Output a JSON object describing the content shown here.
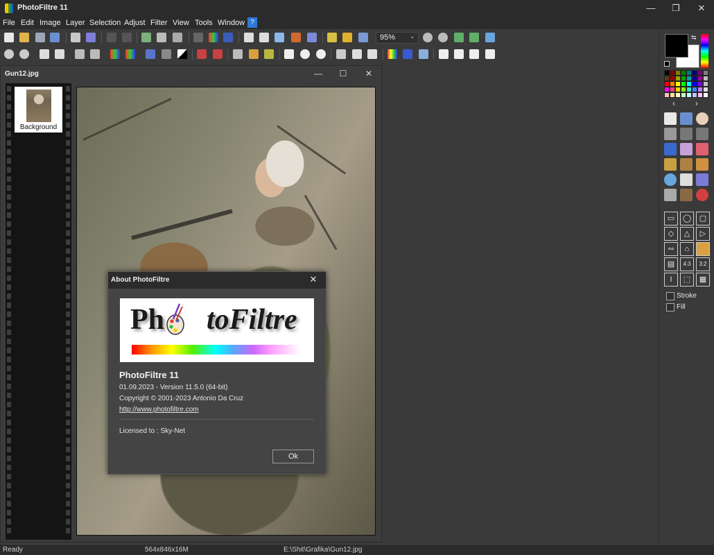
{
  "app": {
    "title": "PhotoFiltre 11",
    "minimize": "—",
    "maximize": "❐",
    "close": "✕"
  },
  "menu": {
    "items": [
      "File",
      "Edit",
      "Image",
      "Layer",
      "Selection",
      "Adjust",
      "Filter",
      "View",
      "Tools",
      "Window"
    ],
    "help": "?"
  },
  "toolbar": {
    "zoom_value": "95%"
  },
  "document": {
    "title": "Gun12.jpg",
    "minimize": "—",
    "maximize": "☐",
    "close": "✕",
    "layer_name": "Background"
  },
  "about_dialog": {
    "title": "About PhotoFiltre",
    "close": "✕",
    "logo_photo": "Ph",
    "logo_filtre": "toFiltre",
    "product_name": "PhotoFiltre 11",
    "version_line": "01.09.2023 - Version 11.5.0 (64-bit)",
    "copyright": "Copyright © 2001-2023  Antonio Da Cruz",
    "link": "http://www.photofiltre.com",
    "license": "Licensed to : Sky-Net",
    "ok_label": "Ok"
  },
  "right_panel": {
    "stroke_label": "Stroke",
    "fill_label": "Fill",
    "prev": "‹",
    "next": "›"
  },
  "status": {
    "state": "Ready",
    "image_info": "564x846x16M",
    "file_path": "E:\\Shit\\Grafika\\Gun12.jpg"
  },
  "colors": {
    "accent": "#2e79d6",
    "background": "#3a3a3a",
    "chrome": "#2b2b2b"
  },
  "palette_colors": [
    "#000000",
    "#7f0000",
    "#7f7f00",
    "#007f00",
    "#007f7f",
    "#00007f",
    "#7f007f",
    "#7f7f7f",
    "#5a3a1a",
    "#a00000",
    "#a0a000",
    "#00a000",
    "#00a0a0",
    "#0000a0",
    "#a000a0",
    "#bdbdbd",
    "#ff0000",
    "#ff8000",
    "#ffff00",
    "#00ff00",
    "#00ffff",
    "#0000ff",
    "#8000ff",
    "#c0c0c0",
    "#ff00ff",
    "#ff4080",
    "#ffd000",
    "#80ff00",
    "#40e0d0",
    "#4080ff",
    "#c080ff",
    "#e0e0e0",
    "#ffc0c0",
    "#ffe0a0",
    "#ffffc0",
    "#c0ffc0",
    "#c0ffff",
    "#c0c0ff",
    "#ffc0ff",
    "#ffffff"
  ]
}
